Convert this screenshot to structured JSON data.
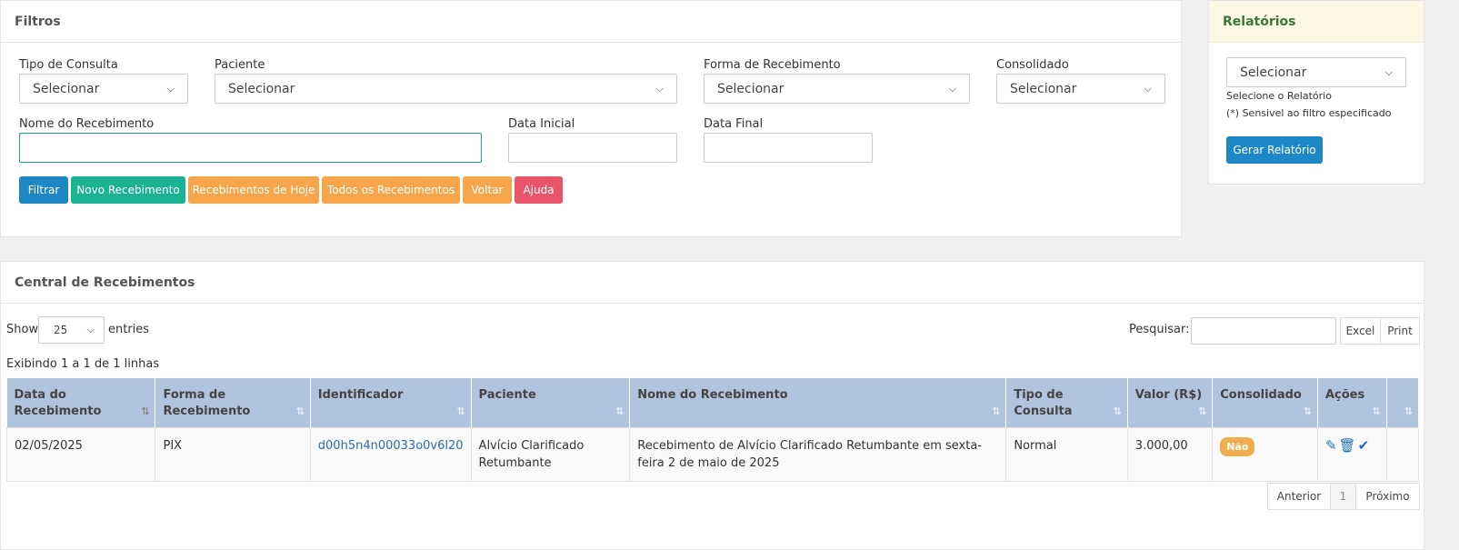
{
  "filtros": {
    "title": "Filtros",
    "tipo_consulta": {
      "label": "Tipo de Consulta",
      "value": "Selecionar"
    },
    "paciente": {
      "label": "Paciente",
      "value": "Selecionar"
    },
    "forma_recebimento": {
      "label": "Forma de Recebimento",
      "value": "Selecionar"
    },
    "consolidado": {
      "label": "Consolidado",
      "value": "Selecionar"
    },
    "nome_recebimento": {
      "label": "Nome do Recebimento",
      "value": ""
    },
    "data_inicial": {
      "label": "Data Inicial",
      "value": ""
    },
    "data_final": {
      "label": "Data Final",
      "value": ""
    },
    "buttons": {
      "filtrar": "Filtrar",
      "novo": "Novo Recebimento",
      "hoje": "Recebimentos de Hoje",
      "todos": "Todos os Recebimentos",
      "voltar": "Voltar",
      "ajuda": "Ajuda"
    },
    "colors": {
      "blue": "#1e88c7",
      "teal": "#1bb394",
      "orange": "#f7a54a",
      "red": "#e9546b"
    }
  },
  "relatorios": {
    "title": "Relatórios",
    "select_value": "Selecionar",
    "hint1": "Selecione o Relatório",
    "hint2": "(*) Sensivel ao filtro especificado",
    "button": "Gerar Relatório"
  },
  "central": {
    "title": "Central de Recebimentos",
    "show_label": "Show",
    "entries_value": "25",
    "entries_label": "entries",
    "search_label": "Pesquisar:",
    "excel": "Excel",
    "print": "Print",
    "info": "Exibindo 1 a 1 de 1 linhas",
    "columns": [
      "Data do Recebimento",
      "Forma de Recebimento",
      "Identificador",
      "Paciente",
      "Nome do Recebimento",
      "Tipo de Consulta",
      "Valor (R$)",
      "Consolidado",
      "Ações",
      ""
    ],
    "rows": [
      {
        "data": "02/05/2025",
        "forma": "PIX",
        "identificador": "d00h5n4n00033o0v6l20",
        "paciente": "Alvício Clarificado Retumbante",
        "nome": "Recebimento de Alvício Clarificado Retumbante em sexta-feira 2 de maio de 2025",
        "tipo": "Normal",
        "valor": "3.000,00",
        "consolidado": "Não"
      }
    ],
    "pagination": {
      "prev": "Anterior",
      "page": "1",
      "next": "Próximo"
    }
  }
}
